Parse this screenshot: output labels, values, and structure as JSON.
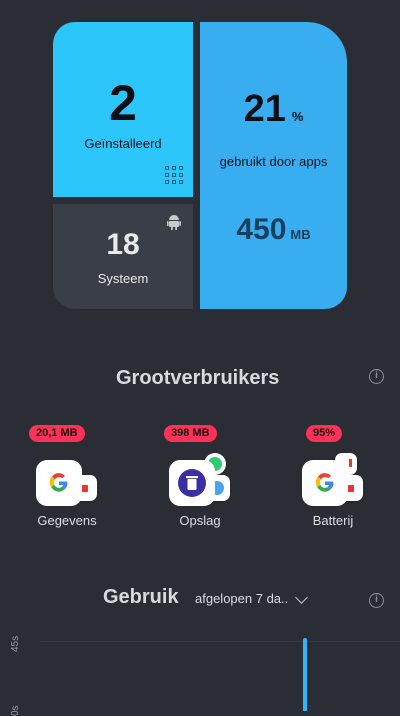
{
  "tiles": {
    "installed": {
      "value": "2",
      "label": "Geïnstalleerd",
      "icon": "apps-grid-icon"
    },
    "system": {
      "value": "18",
      "label": "Systeem",
      "icon": "android-icon"
    },
    "used": {
      "percent": "21",
      "percent_unit": "%",
      "label": "gebruikt door apps",
      "size": "450",
      "size_unit": "MB"
    }
  },
  "consumers": {
    "title": "Grootverbruikers",
    "items": [
      {
        "badge": "20,1 MB",
        "label": "Gegevens",
        "icon": "google-icon"
      },
      {
        "badge": "398 MB",
        "label": "Opslag",
        "icon": "cleaner-icon"
      },
      {
        "badge": "95%",
        "label": "Batterij",
        "icon": "google-icon"
      }
    ]
  },
  "usage": {
    "title": "Gebruik",
    "period": "afgelopen 7 da..",
    "ticks": [
      "45s",
      "0s"
    ]
  },
  "colors": {
    "background": "#2a2d33",
    "installed_tile": "#2cc6fb",
    "used_tile": "#38aef0",
    "badge": "#ff3158",
    "bar": "#36b3f6"
  }
}
